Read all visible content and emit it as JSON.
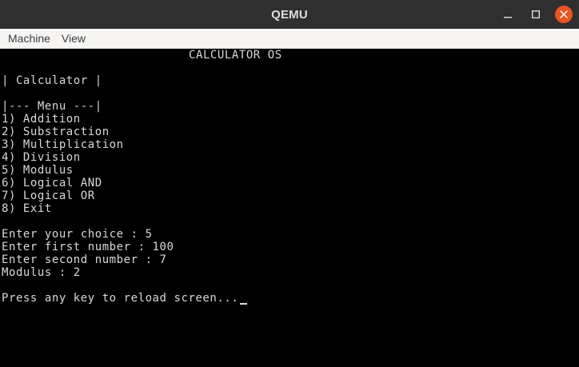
{
  "window": {
    "title": "QEMU",
    "controls": {
      "minimize_icon": "minimize-icon",
      "maximize_icon": "maximize-icon",
      "close_icon": "close-icon",
      "close_color": "#e95420"
    }
  },
  "menubar": {
    "items": [
      {
        "label": "Machine"
      },
      {
        "label": "View"
      }
    ]
  },
  "console": {
    "header": "CALCULATOR OS",
    "app_title": "| Calculator |",
    "menu_header": "|--- Menu ---|",
    "menu_items": [
      "1) Addition",
      "2) Substraction",
      "3) Multiplication",
      "4) Division",
      "5) Modulus",
      "6) Logical AND",
      "7) Logical OR",
      "8) Exit"
    ],
    "session": {
      "choice_line": "Enter your choice : 5",
      "first_number_line": "Enter first number : 100",
      "second_number_line": "Enter second number : 7",
      "result_line": "Modulus : 2"
    },
    "prompt": "Press any key to reload screen...",
    "colors": {
      "background": "#000000",
      "text": "#d9d9d9"
    }
  }
}
